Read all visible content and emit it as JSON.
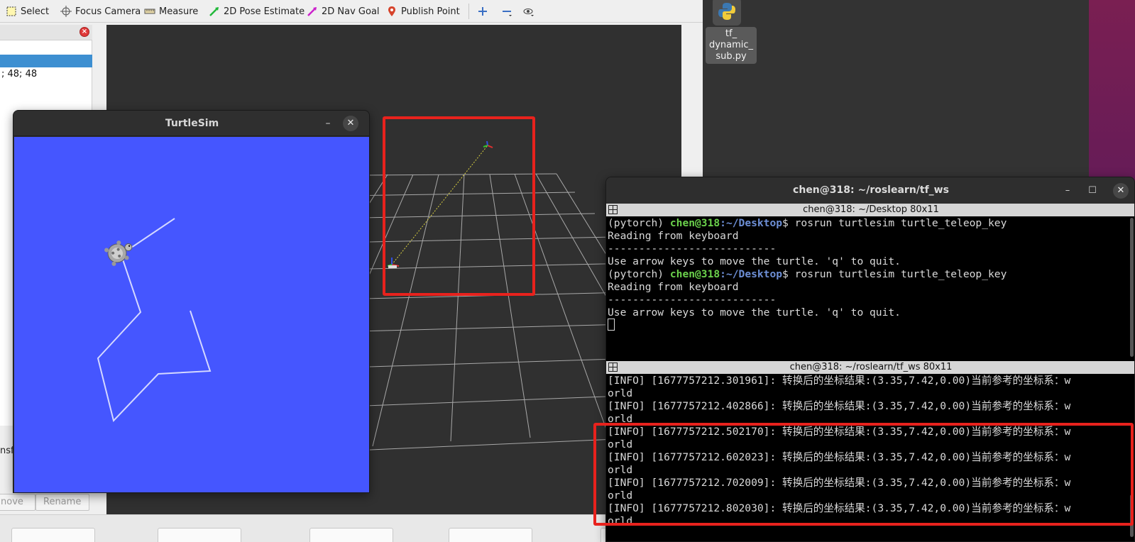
{
  "rviz": {
    "toolbar": {
      "select": "Select",
      "focus_camera": "Focus Camera",
      "measure": "Measure",
      "pose_estimate": "2D Pose Estimate",
      "nav_goal": "2D Nav Goal",
      "publish_point": "Publish Point"
    },
    "panel": {
      "value_text": "; 48; 48",
      "transforms_text": "nsf",
      "remove_button": "nove",
      "rename_button": "Rename"
    }
  },
  "desktop": {
    "file_name": "tf_\ndynamic_\nsub.py"
  },
  "turtlesim": {
    "title": "TurtleSim",
    "background_color": "#4556ff",
    "path_color": "#dcdcff"
  },
  "terminal": {
    "title": "chen@318: ~/roslearn/tf_ws",
    "top_pane": {
      "bar": "chen@318: ~/Desktop 80x11",
      "prompt_env": "(pytorch) ",
      "prompt_user": "chen@318",
      "prompt_path": ":~/Desktop",
      "prompt_cmd": "$ rosrun turtlesim turtle_teleop_key",
      "reading": "Reading from keyboard",
      "dashes": "---------------------------",
      "usage": "Use arrow keys to move the turtle. 'q' to quit."
    },
    "bottom_pane": {
      "bar": "chen@318: ~/roslearn/tf_ws 80x11",
      "lines": [
        "[INFO] [1677757212.301961]: 转换后的坐标结果:(3.35,7.42,0.00)当前参考的坐标系：w",
        "orld",
        "[INFO] [1677757212.402866]: 转换后的坐标结果:(3.35,7.42,0.00)当前参考的坐标系：w",
        "orld",
        "[INFO] [1677757212.502170]: 转换后的坐标结果:(3.35,7.42,0.00)当前参考的坐标系：w",
        "orld",
        "[INFO] [1677757212.602023]: 转换后的坐标结果:(3.35,7.42,0.00)当前参考的坐标系：w",
        "orld",
        "[INFO] [1677757212.702009]: 转换后的坐标结果:(3.35,7.42,0.00)当前参考的坐标系：w",
        "orld",
        "[INFO] [1677757212.802030]: 转换后的坐标结果:(3.35,7.42,0.00)当前参考的坐标系：w",
        "orld"
      ]
    }
  },
  "colors": {
    "highlight": "#e8221d",
    "prompt_user": "#6bd24c",
    "prompt_path": "#6d8fd6"
  }
}
